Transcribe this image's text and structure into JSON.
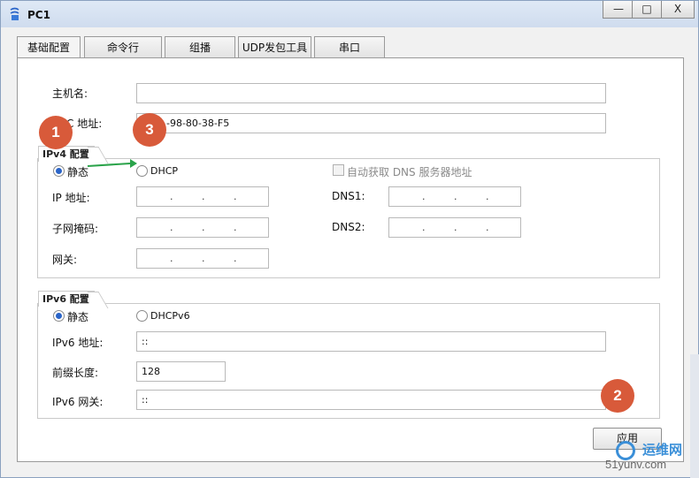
{
  "window": {
    "title": "PC1",
    "min": "—",
    "max": "□",
    "close": "X"
  },
  "tabs": [
    "基础配置",
    "命令行",
    "组播",
    "UDP发包工具",
    "串口"
  ],
  "basic": {
    "hostname_label": "主机名:",
    "hostname_value": "",
    "mac_label_visible": "C 地址:",
    "mac_value_visible": "-98-80-38-F5"
  },
  "ipv4": {
    "title": "IPv4 配置",
    "static": "静态",
    "dhcp": "DHCP",
    "auto_dns": "自动获取 DNS 服务器地址",
    "ip_label": "IP 地址:",
    "mask_label": "子网掩码:",
    "gateway_label": "网关:",
    "dns1_label": "DNS1:",
    "dns2_label": "DNS2:",
    "static_selected": true
  },
  "ipv6": {
    "title": "IPv6 配置",
    "static": "静态",
    "dhcpv6": "DHCPv6",
    "addr_label": "IPv6 地址:",
    "addr_value": "::",
    "prefix_label": "前缀长度:",
    "prefix_value": "128",
    "gw_label": "IPv6 网关:",
    "gw_value": "::"
  },
  "apply_label": "应用",
  "badges": [
    "1",
    "2",
    "3"
  ],
  "watermark": {
    "cn": "运维网",
    "en": "51yunv.com"
  },
  "colors": {
    "badge": "#d85a3a",
    "arrow": "#2aa34a",
    "radio_on": "#2a64c8"
  }
}
